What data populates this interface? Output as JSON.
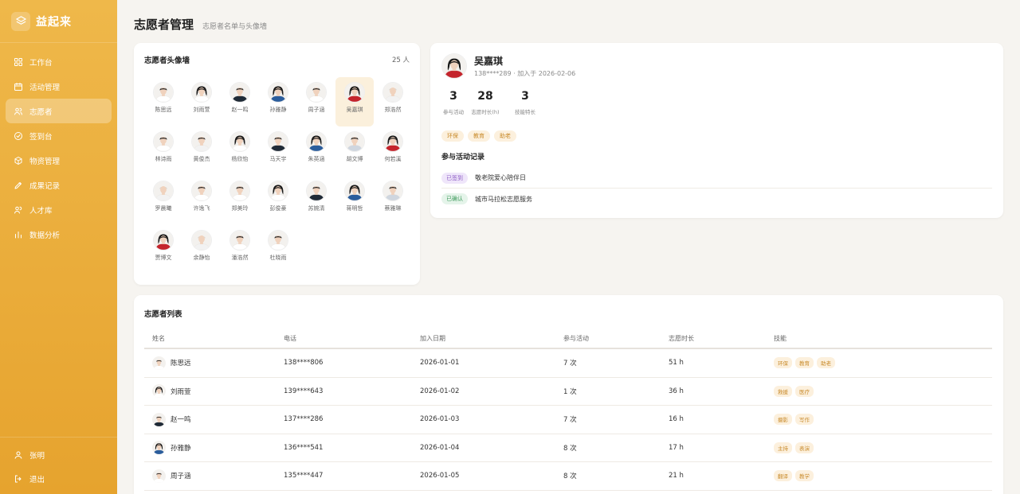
{
  "app": {
    "brand": "益起来"
  },
  "sidebar": {
    "items": [
      {
        "label": "工作台",
        "icon": "grid-icon"
      },
      {
        "label": "活动管理",
        "icon": "calendar-icon"
      },
      {
        "label": "志愿者",
        "icon": "users-icon",
        "active": true
      },
      {
        "label": "签到台",
        "icon": "check-circle-icon"
      },
      {
        "label": "物资管理",
        "icon": "box-icon"
      },
      {
        "label": "成果记录",
        "icon": "pen-icon"
      },
      {
        "label": "人才库",
        "icon": "team-icon"
      },
      {
        "label": "数据分析",
        "icon": "bar-chart-icon"
      }
    ],
    "user": "张明",
    "logout": "退出"
  },
  "header": {
    "title": "志愿者管理",
    "subtitle": "志愿者名单与头像墙"
  },
  "wall": {
    "title": "志愿者头像墙",
    "count": "25 人",
    "people": [
      {
        "name": "陈思远",
        "g": "m",
        "top": "#ffffff"
      },
      {
        "name": "刘雨萱",
        "g": "f",
        "top": "#ffffff"
      },
      {
        "name": "赵一鸣",
        "g": "m",
        "top": "#1f2a36"
      },
      {
        "name": "孙雅静",
        "g": "f",
        "top": "#2b5d9c"
      },
      {
        "name": "周子涵",
        "g": "m",
        "top": "#ffffff"
      },
      {
        "name": "吴嘉琪",
        "g": "f",
        "top": "#c4242c",
        "selected": true
      },
      {
        "name": "郑浩然",
        "g": "o",
        "top": "#f2f2f2"
      },
      {
        "name": "林诗雨",
        "g": "m",
        "top": "#ffffff"
      },
      {
        "name": "黄俊杰",
        "g": "m",
        "top": "#f2f2f2"
      },
      {
        "name": "杨欣怡",
        "g": "f",
        "top": "#ffffff"
      },
      {
        "name": "马天宇",
        "g": "m",
        "top": "#1f2a36"
      },
      {
        "name": "朱英涵",
        "g": "f",
        "top": "#2b5d9c"
      },
      {
        "name": "胡文博",
        "g": "m",
        "top": "#cfd6df"
      },
      {
        "name": "何若溪",
        "g": "f",
        "top": "#c4242c"
      },
      {
        "name": "罗晨曦",
        "g": "o",
        "top": "#f2f2f2"
      },
      {
        "name": "许逸飞",
        "g": "m",
        "top": "#ffffff"
      },
      {
        "name": "郑美玲",
        "g": "m",
        "top": "#ffffff"
      },
      {
        "name": "彭俊豪",
        "g": "f",
        "top": "#ffffff"
      },
      {
        "name": "苏婉清",
        "g": "m",
        "top": "#1f2a36"
      },
      {
        "name": "蒋明哲",
        "g": "f",
        "top": "#2b5d9c"
      },
      {
        "name": "蔡雅琳",
        "g": "m",
        "top": "#cfd6df"
      },
      {
        "name": "贾博文",
        "g": "f",
        "top": "#c4242c"
      },
      {
        "name": "余静怡",
        "g": "o",
        "top": "#f2f2f2"
      },
      {
        "name": "潘浩然",
        "g": "m",
        "top": "#ffffff"
      },
      {
        "name": "杜晓雨",
        "g": "m",
        "top": "#ffffff"
      }
    ]
  },
  "detail": {
    "name": "吴嘉琪",
    "phone": "138****289",
    "joined": "加入于 2026-02-06",
    "stats": [
      {
        "num": "3",
        "label": "参与活动"
      },
      {
        "num": "28",
        "label": "志愿时长(h)"
      },
      {
        "num": "3",
        "label": "技能特长"
      }
    ],
    "tags": [
      "环保",
      "教育",
      "助老"
    ],
    "records_title": "参与活动记录",
    "records": [
      {
        "status": "已签到",
        "kind": "purple",
        "name": "敬老院爱心陪伴日"
      },
      {
        "status": "已确认",
        "kind": "green",
        "name": "城市马拉松志愿服务"
      }
    ]
  },
  "list": {
    "title": "志愿者列表",
    "columns": [
      "姓名",
      "电话",
      "加入日期",
      "参与活动",
      "志愿时长",
      "技能"
    ],
    "rows": [
      {
        "name": "陈思远",
        "g": "m",
        "top": "#ffffff",
        "phone": "138****806",
        "date": "2026-01-01",
        "acts": "7 次",
        "hours": "51 h",
        "skills": [
          "环保",
          "教育",
          "助老"
        ]
      },
      {
        "name": "刘雨萱",
        "g": "f",
        "top": "#ffffff",
        "phone": "139****643",
        "date": "2026-01-02",
        "acts": "1 次",
        "hours": "36 h",
        "skills": [
          "救援",
          "医疗"
        ]
      },
      {
        "name": "赵一鸣",
        "g": "m",
        "top": "#1f2a36",
        "phone": "137****286",
        "date": "2026-01-03",
        "acts": "7 次",
        "hours": "16 h",
        "skills": [
          "摄影",
          "写作"
        ]
      },
      {
        "name": "孙雅静",
        "g": "f",
        "top": "#2b5d9c",
        "phone": "136****541",
        "date": "2026-01-04",
        "acts": "8 次",
        "hours": "17 h",
        "skills": [
          "主持",
          "表演"
        ]
      },
      {
        "name": "周子涵",
        "g": "m",
        "top": "#ffffff",
        "phone": "135****447",
        "date": "2026-01-05",
        "acts": "8 次",
        "hours": "21 h",
        "skills": [
          "翻译",
          "教学"
        ]
      }
    ]
  }
}
